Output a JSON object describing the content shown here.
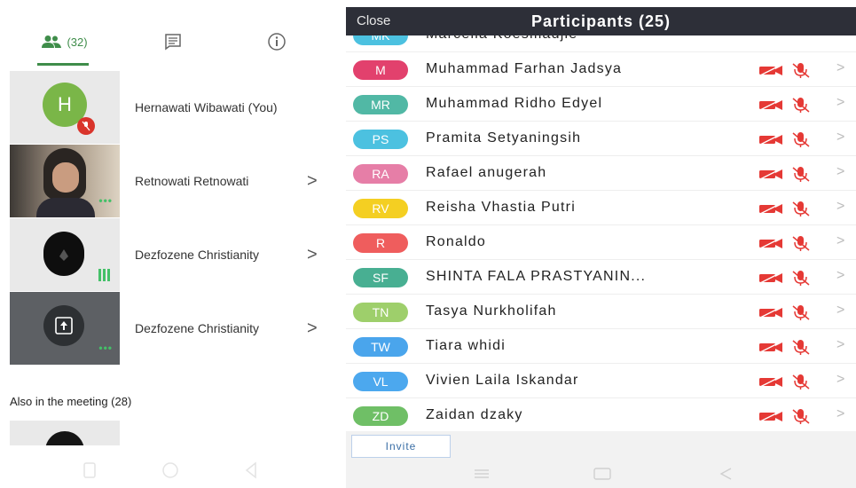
{
  "left": {
    "tabs": {
      "people_count": "(32)"
    },
    "rows": [
      {
        "initial": "H",
        "name": "Hernawati Wibawati (You)"
      },
      {
        "name": "Retnowati Retnowati",
        "chev": ">"
      },
      {
        "name": "Dezfozene Christianity",
        "chev": ">"
      },
      {
        "name": "Dezfozene Christianity",
        "chev": ">"
      }
    ],
    "also_label": "Also in the meeting (28)"
  },
  "right": {
    "close": "Close",
    "title": "Participants (25)",
    "partial_name": "Marcella Koesmadjie",
    "partial_initials": "MK",
    "participants": [
      {
        "initials": "M",
        "name": "Muhammad Farhan Jadsya",
        "color": "#e2416d"
      },
      {
        "initials": "MR",
        "name": "Muhammad Ridho Edyel",
        "color": "#51b8a5"
      },
      {
        "initials": "PS",
        "name": "Pramita Setyaningsih",
        "color": "#4cc1e0"
      },
      {
        "initials": "RA",
        "name": "Rafael anugerah",
        "color": "#e67ea7"
      },
      {
        "initials": "RV",
        "name": "Reisha Vhastia Putri",
        "color": "#f4cf22"
      },
      {
        "initials": "R",
        "name": "Ronaldo",
        "color": "#ef5d5d"
      },
      {
        "initials": "SF",
        "name": "SHINTA FALA PRASTYANIN...",
        "color": "#48af92"
      },
      {
        "initials": "TN",
        "name": "Tasya Nurkholifah",
        "color": "#9ecf6b"
      },
      {
        "initials": "TW",
        "name": "Tiara whidi",
        "color": "#4aa5ec"
      },
      {
        "initials": "VL",
        "name": "Vivien Laila Iskandar",
        "color": "#4ca8ee"
      },
      {
        "initials": "ZD",
        "name": "Zaidan dzaky",
        "color": "#6fbf66"
      }
    ],
    "arrow": ">",
    "invite": "Invite"
  },
  "colors": {
    "accent_green": "#3f8d4a",
    "mute_red": "#e53935",
    "header_dark": "#2d2f38"
  }
}
